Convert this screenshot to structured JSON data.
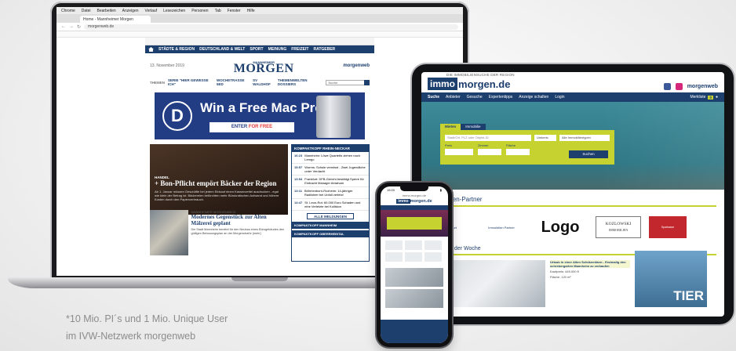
{
  "laptop": {
    "menubar": [
      "Chrome",
      "Datei",
      "Bearbeiten",
      "Anzeigen",
      "Verlauf",
      "Lesezeichen",
      "Personen",
      "Tab",
      "Fenster",
      "Hilfe"
    ],
    "tab_title": "Home - Mannheimer Morgen",
    "url": "morgenweb.de",
    "site": {
      "nav": [
        "STÄDTE & REGION",
        "DEUTSCHLAND & WELT",
        "SPORT",
        "MEINUNG",
        "FREIZEIT",
        "RATGEBER"
      ],
      "date": "13. November 2019",
      "masthead_small": "MANNHEIMER",
      "masthead": "MORGEN",
      "network": "morgenweb",
      "themes_label": "THEMEN",
      "themes": [
        "SERIE \"HIER GEWESSE ICH\"",
        "WOCHETRASSE 5ED",
        "SV WALDHOF",
        "THEMENWELTEN DOSSIERS"
      ],
      "search_placeholder": "Suche",
      "ad": {
        "logo": "D",
        "headline": "Win a Free Mac Pro",
        "cta_prefix": "ENTER ",
        "cta_accent": "FOR FREE"
      },
      "lead": {
        "kicker": "HANDEL",
        "title": "+ Bon-Pflicht empört Bäcker der Region",
        "teaser": "Ab 1. Januar müssen Geschäfte bei jedem Einkauf einen Kassenzettel ausdrucken - egal wie klein der Betrag ist. Bäckereien befürchten mehr Bürokratischen Aufwand und höhere Kosten durch den Papierverbrauch."
      },
      "ticker": {
        "title": "KOMPAKTKOPF RHEIN-NECKAR",
        "items": [
          {
            "time": "16:23",
            "text": "Mannheim: Löwe Quartetts ziehen nach Lemgo"
          },
          {
            "time": "15:57",
            "text": "Worms: Schule vermisst - Zwei Jugendliche unter Verdacht"
          },
          {
            "time": "13:54",
            "text": "Frankfurt: DFB-Gericht bestätigt Sperre für Eintracht Manager Abraham"
          },
          {
            "time": "13:11",
            "text": "Böhmenborn-Roxheim: 14-jähriger Radfahrer bei Unfall verletzt"
          },
          {
            "time": "14:47",
            "text": "St. Leon-Rot: 60.000 Euro Schaden und eine Verletzte bei Kollision"
          }
        ],
        "button": "ALLE MELDUNGEN",
        "sub1": "KOMPAKTKOPF MANNHEIM",
        "sub2": "KOMPAKTKOPF OBERRHEINTAL"
      },
      "second": {
        "kicker": "MANNHEIMER MORGENBECK",
        "title": "Modernes Gegenstück zur Alten Mälzerei geplant",
        "teaser": "Die Stadt Mannheim bereitet für den Neubau eines Bürogebäudes den gültigen Bebauungsplan an der Morgenstraße [mehr]"
      }
    }
  },
  "tablet": {
    "kicker": "DIE IMMOBILIENSUCHE DER REGION",
    "logo_immo": "immo",
    "logo_rest": "morgen.de",
    "network": "morgenweb",
    "nav": [
      "Suche",
      "Anbieter",
      "Gesuche",
      "Expertentipps",
      "Anzeige schalten",
      "Login"
    ],
    "merkliste": "Merkliste",
    "merkliste_count": "0",
    "search_tabs": [
      "Mieten",
      "Immobilie"
    ],
    "search_placeholder": "Stadt/Ort, PLZ oder Objekt-ID",
    "search_radius": "Umkreis",
    "search_type": "Alle Immobilientypen",
    "filter_labels": [
      "Preis",
      "Zimmer",
      "Fläche"
    ],
    "search_button": "Suchen",
    "partners_title": "Immobilien-Partner",
    "partners": [
      "Frankfurt",
      "Immobilien Partner",
      "Logo",
      "KOZLOWSKI",
      "IMMOBILIEN",
      "Sparkasse"
    ],
    "week_title": "Immobilie der Woche",
    "week_item_title": "Urlaub in einer Alten Schützenfarm - Erstmalig den schrebergarten Mannheim zu verkaufen",
    "week_item_price": "Kaufpreis: 449.000 €",
    "week_item_area": "Fläche: 120 m²",
    "ad_label": "TIER"
  },
  "phone": {
    "time": "15:00",
    "url": "immo.morgen.de",
    "logo_immo": "immo",
    "logo_rest": "morgen.de"
  },
  "footnote": {
    "line1": "*10 Mio. PI´s und 1 Mio. Unique User",
    "line2": "im IVW-Netzwerk morgenweb"
  },
  "colors": {
    "brand_blue": "#1d3f6e",
    "accent_green": "#c6d230",
    "ad_blue": "#233d84",
    "facebook": "#3b5998",
    "instagram": "#d6287a"
  }
}
